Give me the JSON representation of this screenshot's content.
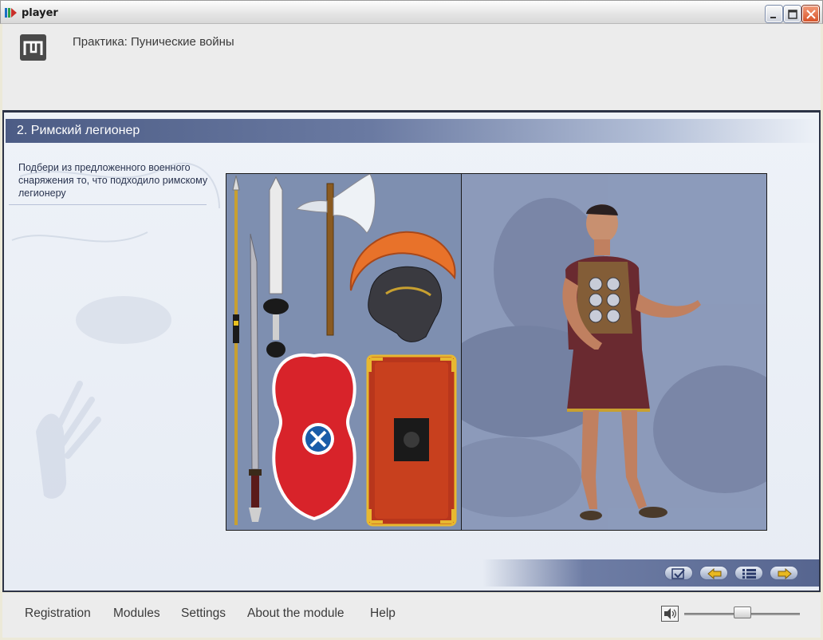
{
  "window": {
    "title": "player"
  },
  "header": {
    "course_title": "Практика: Пунические войны"
  },
  "section": {
    "title": "2. Римский легионер",
    "instruction": "Подбери из предложенного военного снаряжения то, что подходило римскому легионеру"
  },
  "equipment": [
    "spear",
    "sword",
    "long-sword",
    "axe",
    "crested-helmet",
    "oval-shield",
    "scutum-shield"
  ],
  "nav_buttons": [
    "check-icon",
    "arrow-left-icon",
    "list-icon",
    "arrow-right-icon"
  ],
  "footer": {
    "menu": [
      "Registration",
      "Modules",
      "Settings",
      "About the module",
      "Help"
    ],
    "volume_level": 0.5
  },
  "colors": {
    "header_dark": "#2c3346",
    "section_bar": "#4c5c85",
    "shield_red": "#d8232a",
    "scutum": "#b8361c",
    "helmet_crest": "#e8722a"
  }
}
